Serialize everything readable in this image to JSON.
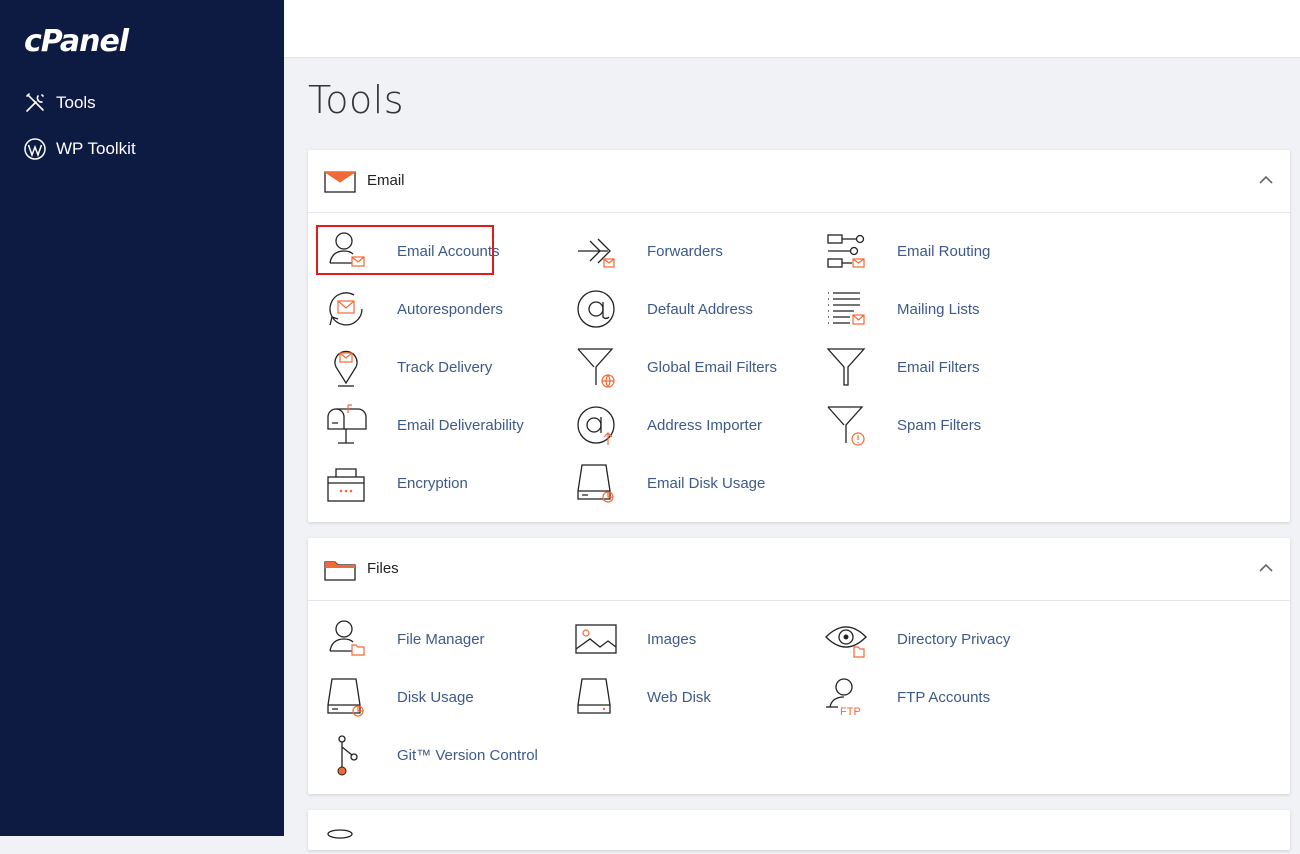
{
  "brand": {
    "logo": "cPanel"
  },
  "sidebar": {
    "items": [
      {
        "label": "Tools",
        "icon": "tools-icon"
      },
      {
        "label": "WP Toolkit",
        "icon": "wordpress-icon"
      }
    ]
  },
  "page": {
    "title": "Tools"
  },
  "sections": {
    "email": {
      "title": "Email",
      "tools": [
        {
          "label": "Email Accounts",
          "icon": "email-accounts-icon"
        },
        {
          "label": "Forwarders",
          "icon": "forwarders-icon"
        },
        {
          "label": "Email Routing",
          "icon": "email-routing-icon"
        },
        {
          "label": "Autoresponders",
          "icon": "autoresponders-icon"
        },
        {
          "label": "Default Address",
          "icon": "default-address-icon"
        },
        {
          "label": "Mailing Lists",
          "icon": "mailing-lists-icon"
        },
        {
          "label": "Track Delivery",
          "icon": "track-delivery-icon"
        },
        {
          "label": "Global Email Filters",
          "icon": "global-email-filters-icon"
        },
        {
          "label": "Email Filters",
          "icon": "email-filters-icon"
        },
        {
          "label": "Email Deliverability",
          "icon": "email-deliverability-icon"
        },
        {
          "label": "Address Importer",
          "icon": "address-importer-icon"
        },
        {
          "label": "Spam Filters",
          "icon": "spam-filters-icon"
        },
        {
          "label": "Encryption",
          "icon": "encryption-icon"
        },
        {
          "label": "Email Disk Usage",
          "icon": "email-disk-usage-icon"
        }
      ]
    },
    "files": {
      "title": "Files",
      "tools": [
        {
          "label": "File Manager",
          "icon": "file-manager-icon"
        },
        {
          "label": "Images",
          "icon": "images-icon"
        },
        {
          "label": "Directory Privacy",
          "icon": "directory-privacy-icon"
        },
        {
          "label": "Disk Usage",
          "icon": "disk-usage-icon"
        },
        {
          "label": "Web Disk",
          "icon": "web-disk-icon"
        },
        {
          "label": "FTP Accounts",
          "icon": "ftp-accounts-icon"
        },
        {
          "label": "Git™ Version Control",
          "icon": "git-icon"
        }
      ]
    }
  },
  "colors": {
    "sidebar": "#0d1a42",
    "accent": "#f06a35",
    "link": "#3d5a8a",
    "highlight": "#e31b1b"
  }
}
